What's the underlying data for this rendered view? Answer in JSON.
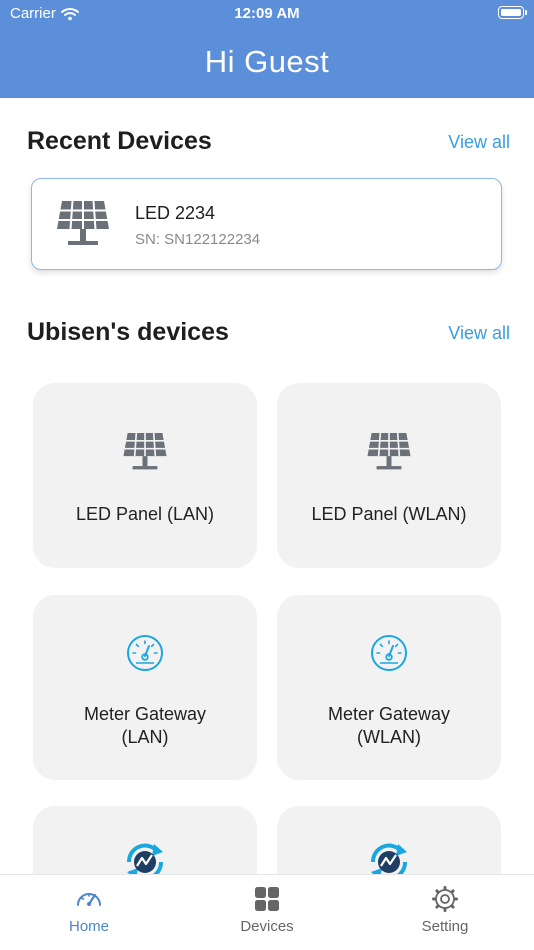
{
  "status_bar": {
    "carrier": "Carrier",
    "time": "12:09 AM"
  },
  "header": {
    "greeting": "Hi Guest"
  },
  "recent": {
    "title": "Recent Devices",
    "view_all": "View all",
    "device": {
      "name": "LED 2234",
      "sn": "SN: SN122122234",
      "icon": "solar-panel-icon"
    }
  },
  "devices": {
    "title": "Ubisen's devices",
    "view_all": "View all",
    "items": [
      {
        "label": "LED Panel (LAN)",
        "icon": "solar-panel-icon"
      },
      {
        "label": "LED Panel (WLAN)",
        "icon": "solar-panel-icon"
      },
      {
        "label_line1": "Meter Gateway",
        "label_line2": "(LAN)",
        "icon": "gauge-icon"
      },
      {
        "label_line1": "Meter Gateway",
        "label_line2": "(WLAN)",
        "icon": "gauge-icon"
      },
      {
        "icon": "sync-chart-icon"
      },
      {
        "icon": "sync-chart-icon"
      }
    ]
  },
  "tabbar": {
    "tabs": [
      {
        "label": "Home",
        "icon": "speedometer-icon",
        "active": true
      },
      {
        "label": "Devices",
        "icon": "grid-icon",
        "active": false
      },
      {
        "label": "Setting",
        "icon": "gear-icon",
        "active": false
      }
    ]
  },
  "colors": {
    "header": "#5b8fd9",
    "link": "#3a9de0",
    "accent": "#1aa7e0",
    "tile": "#f2f2f2",
    "tab_active": "#4a86c8",
    "icon_gray": "#6b7178"
  }
}
